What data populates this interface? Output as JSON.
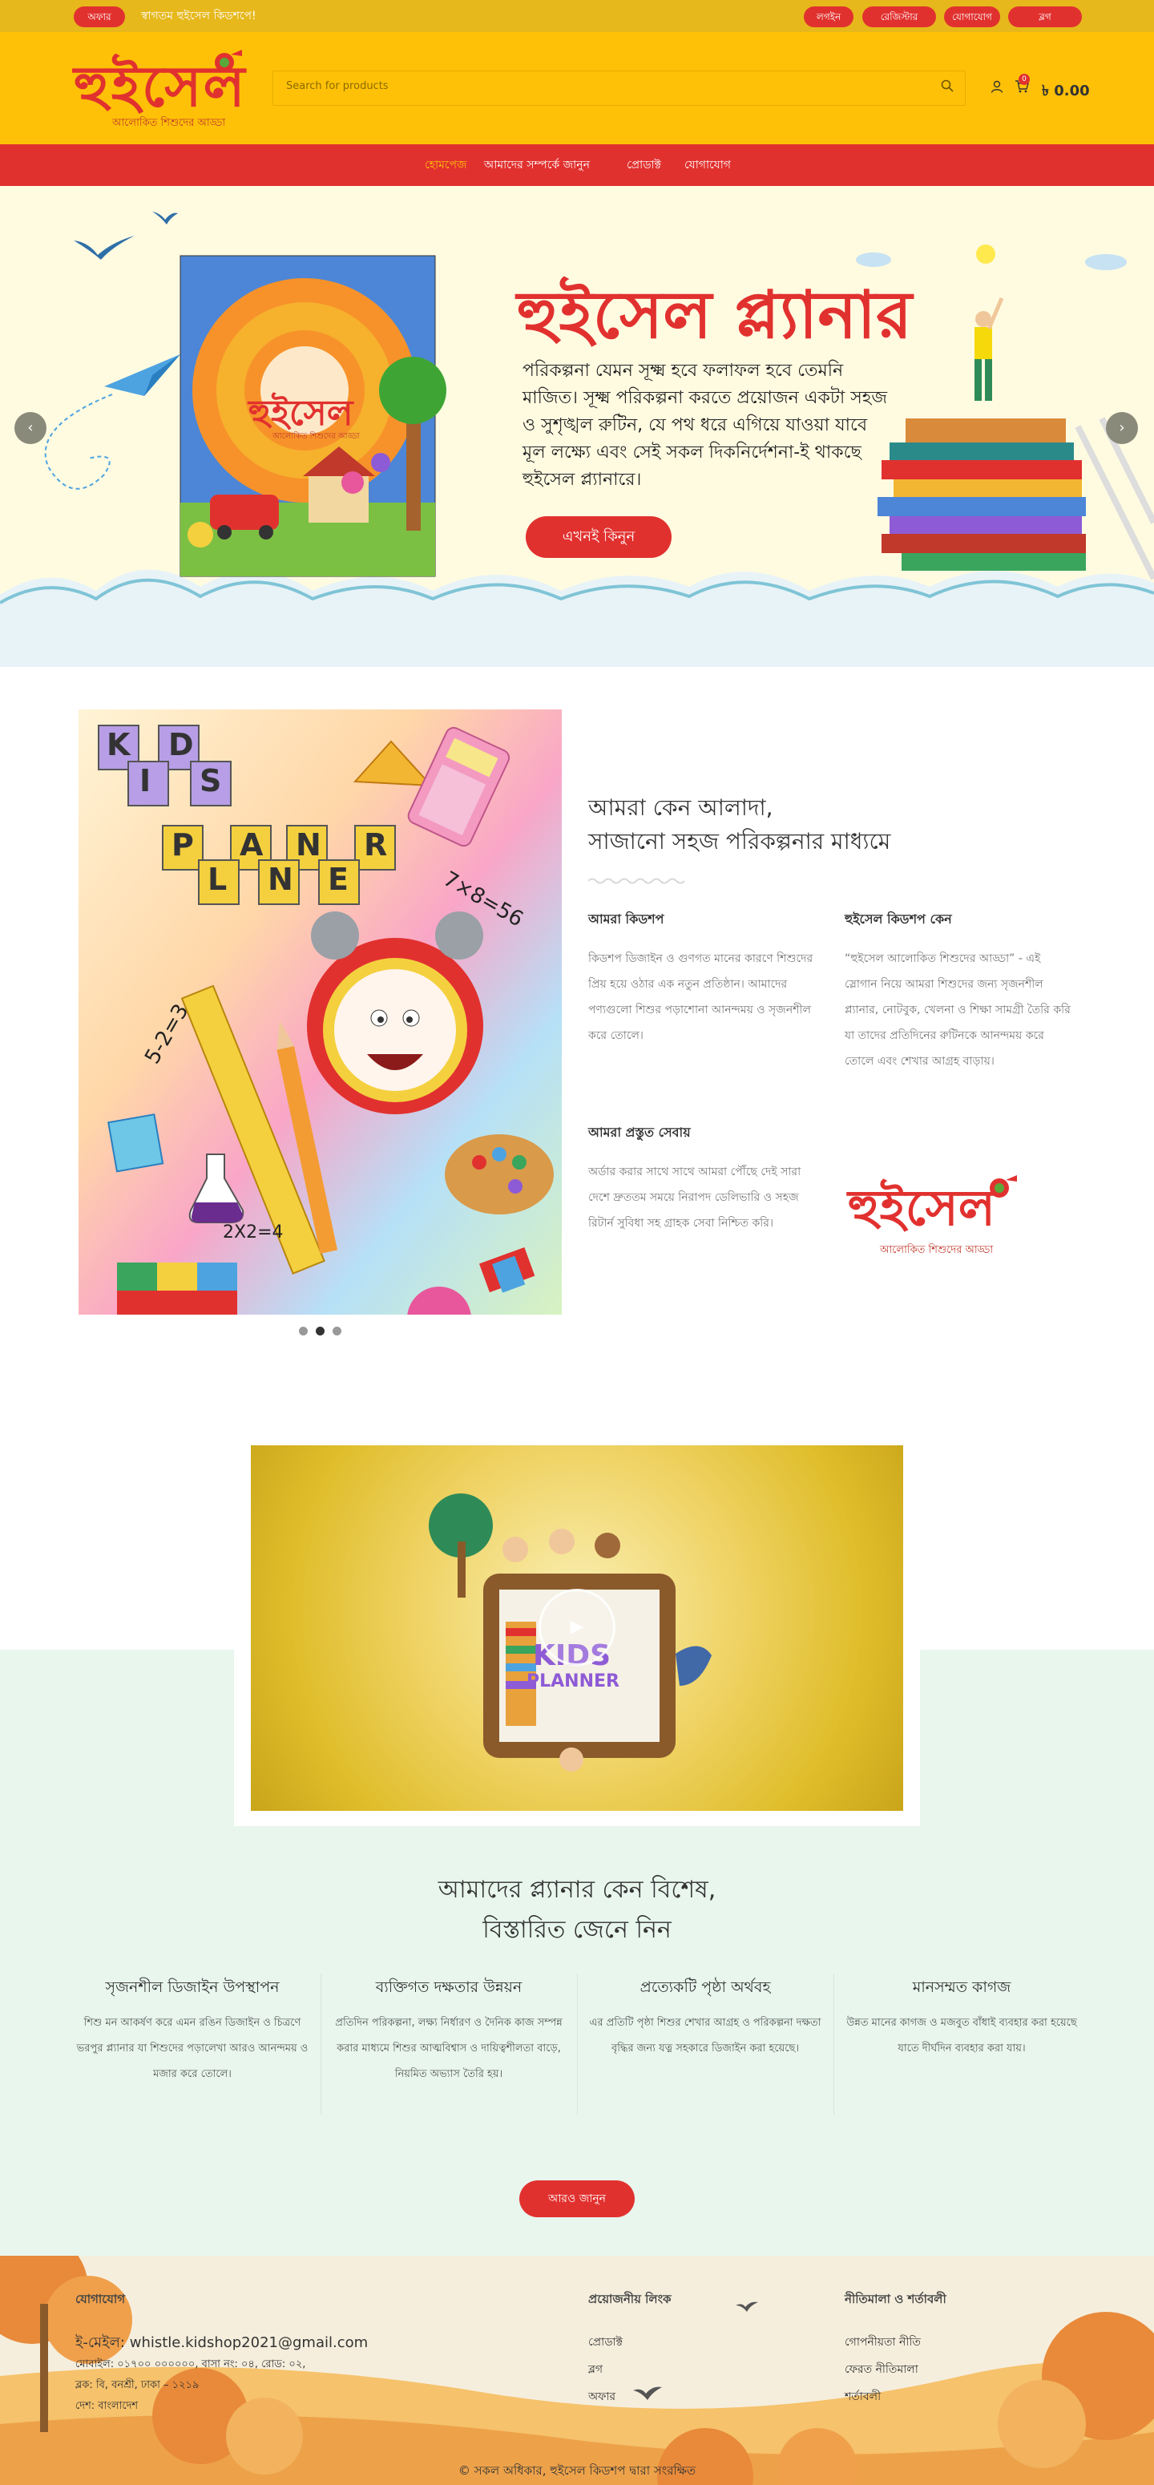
{
  "topbar": {
    "badge": "অফার",
    "message": "স্বাগতম হুইসেল কিডশপে!",
    "links": [
      "লগইন",
      "রেজিস্টার",
      "যোগাযোগ",
      "ব্লগ"
    ]
  },
  "header": {
    "logo": "হুইসেল",
    "logo_tagline": "আলোকিত শিশুদের আড্ডা",
    "search_placeholder": "Search for products",
    "cart_count": "0",
    "cart_total": "৳ 0.00"
  },
  "nav": {
    "items": [
      "হোমপেজ",
      "আমাদের সম্পর্কে জানুন",
      "প্রোডাক্ট",
      "যোগাযোগ"
    ]
  },
  "hero": {
    "title": "হুইসেল প্ল্যানার",
    "body": "পরিকল্পনা যেমন সূক্ষ্ম হবে ফলাফল হবে তেমনি মাজিত। সূক্ষ্ম পরিকল্পনা করতে প্রয়োজন একটা সহজ ও সুশৃঙ্খল রুটিন, যে পথ ধরে এগিয়ে যাওয়া যাবে মূল লক্ষ্যে এবং সেই সকল দিকনির্দেশনা-ই থাকছে হুইসেল প্ল্যানারে।",
    "button": "এখনই কিনুন",
    "book_logo": "হুইসেল",
    "book_tagline": "আলোকিত শিশুদের আড্ডা"
  },
  "about": {
    "heading_line1": "আমরা কেন আলাদা,",
    "heading_line2": "সাজানো সহজ পরিকল্পনার মাধ্যমে",
    "col1_title": "আমরা কিডশপ",
    "col1_text": "কিডশপ ডিজাইন ও গুণগত মানের কারণে শিশুদের প্রিয় হয়ে ওঠার এক নতুন প্রতিষ্ঠান। আমাদের পণ্যগুলো শিশুর পড়াশোনা আনন্দময় ও সৃজনশীল করে তোলে।",
    "col2_title": "আমরা প্রস্তুত সেবায়",
    "col2_text": "অর্ডার করার সাথে সাথে আমরা পৌঁছে দেই সারা দেশে দ্রুততম সময়ে নিরাপদ ডেলিভারি ও সহজ রিটার্ন সুবিধা সহ গ্রাহক সেবা নিশ্চিত করি।",
    "col3_title": "হুইসেল কিডশপ কেন",
    "col3_text": "“হুইসেল আলোকিত শিশুদের আড্ডা” - এই স্লোগান নিয়ে আমরা শিশুদের জন্য সৃজনশীল প্ল্যানার, নোটবুক, খেলনা ও শিক্ষা সামগ্রী তৈরি করি যা তাদের প্রতিদিনের রুটিনকে আনন্দময় করে তোলে এবং শেখার আগ্রহ বাড়ায়।",
    "logo": "হুইসেল",
    "logo_tagline": "আলোকিত শিশুদের আড্ডা",
    "kids_letters": [
      "K",
      "D",
      "I",
      "S"
    ],
    "planner_letters": [
      "P",
      "A",
      "N",
      "R",
      "L",
      "N",
      "E"
    ],
    "math1": "7×8=56",
    "math2": "5-2=3",
    "math3": "2X2=4"
  },
  "video": {
    "play_icon": "▶",
    "title_line1": "KIDS",
    "title_line2": "PLANNER"
  },
  "why": {
    "heading_line1": "আমাদের প্ল্যানার কেন বিশেষ,",
    "heading_line2": "বিস্তারিত জেনে নিন",
    "features": [
      {
        "title": "সৃজনশীল ডিজাইন উপস্থাপন",
        "text": "শিশু মন আকর্ষণ করে এমন রঙিন ডিজাইন ও চিত্রণে ভরপুর প্ল্যানার যা শিশুদের পড়ালেখা আরও আনন্দময় ও মজার করে তোলে।"
      },
      {
        "title": "ব্যক্তিগত দক্ষতার উন্নয়ন",
        "text": "প্রতিদিন পরিকল্পনা, লক্ষ্য নির্ধারণ ও দৈনিক কাজ সম্পন্ন করার মাধ্যমে শিশুর আত্মবিশ্বাস ও দায়িত্বশীলতা বাড়ে, নিয়মিত অভ্যাস তৈরি হয়।"
      },
      {
        "title": "প্রত্যেকটি পৃষ্ঠা অর্থবহ",
        "text": "এর প্রতিটি পৃষ্ঠা শিশুর শেখার আগ্রহ ও পরিকল্পনা দক্ষতা বৃদ্ধির জন্য যত্ন সহকারে ডিজাইন করা হয়েছে।"
      },
      {
        "title": "মানসম্মত কাগজ",
        "text": "উন্নত মানের কাগজ ও মজবুত বাঁধাই ব্যবহার করা হয়েছে যাতে দীর্ঘদিন ব্যবহার করা যায়।"
      }
    ],
    "button": "আরও জানুন"
  },
  "footer": {
    "col1_title": "যোগাযোগ",
    "email_label": "ই-মেইল:",
    "email": "whistle.kidshop2021@gmail.com",
    "phone_line": "মোবাইল: ০১৭০০ ০০০০০০, বাসা নং: ০৪, রোড: ০২,",
    "address_line": "ব্লক: বি, বনশ্রী, ঢাকা – ১২১৯",
    "country_line": "দেশ: বাংলাদেশ",
    "col2_title": "প্রয়োজনীয় লিংক",
    "col2_links": [
      "প্রোডাক্ট",
      "ব্লগ",
      "অফার"
    ],
    "col3_title": "নীতিমালা ও শর্তাবলী",
    "col3_links": [
      "গোপনীয়তা নীতি",
      "ফেরত নীতিমালা",
      "শর্তাবলী"
    ],
    "copyright": "© সকল অধিকার, হুইসেল কিডশপ দ্বারা সংরক্ষিত"
  }
}
